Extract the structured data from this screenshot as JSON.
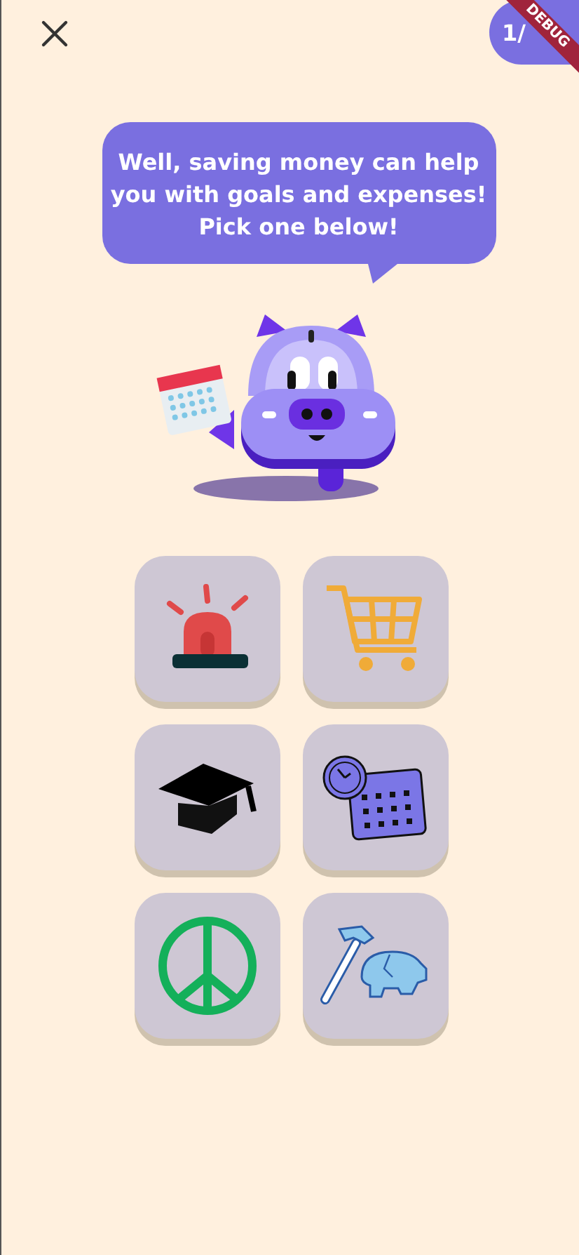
{
  "progress": {
    "counter": "1/"
  },
  "debug_banner": {
    "label": "DEBUG"
  },
  "speech_bubble": {
    "text": "Well, saving money can help you with goals and expenses! Pick one below!"
  },
  "options": [
    {
      "kind": "emergency"
    },
    {
      "kind": "shopping"
    },
    {
      "kind": "education"
    },
    {
      "kind": "schedule"
    },
    {
      "kind": "peace"
    },
    {
      "kind": "savings"
    }
  ]
}
